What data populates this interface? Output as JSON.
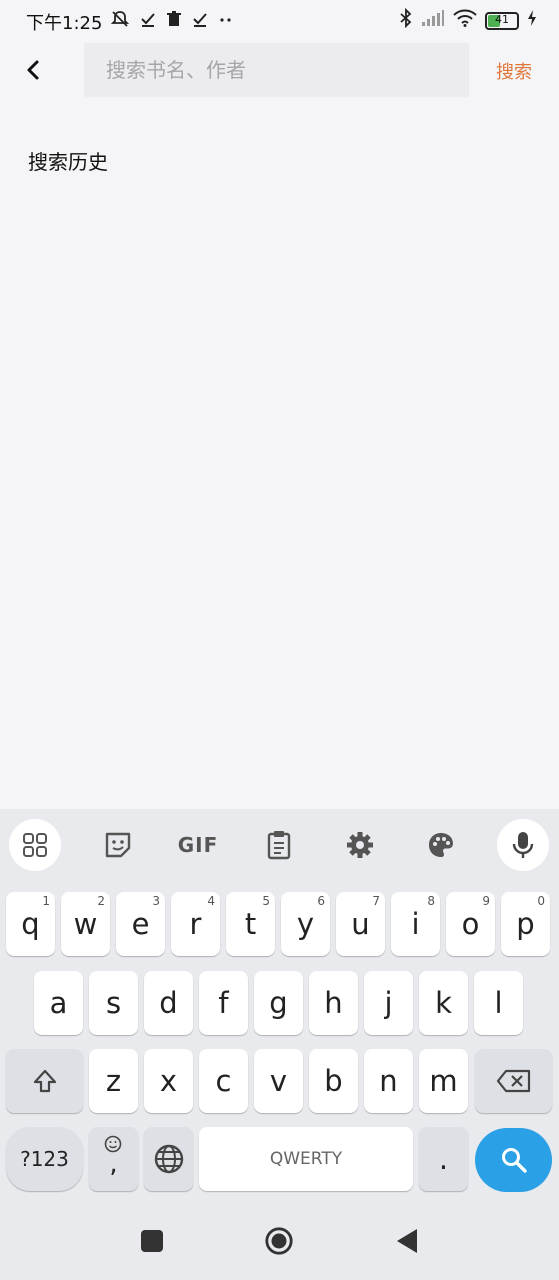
{
  "status_bar": {
    "time": "下午1:25",
    "battery_level": "41",
    "left_icons": [
      "bell-off-icon",
      "check-icon",
      "trash-icon",
      "check-icon",
      "more-dots-icon"
    ],
    "right_icons": [
      "bluetooth-icon",
      "signal-icon",
      "wifi-icon",
      "battery-icon",
      "charging-icon"
    ]
  },
  "header": {
    "search_placeholder": "搜索书名、作者",
    "search_value": "",
    "search_button_label": "搜索"
  },
  "history": {
    "title": "搜索历史",
    "items": []
  },
  "keyboard": {
    "toolbar": [
      "apps-icon",
      "sticker-icon",
      "GIF",
      "clipboard-icon",
      "settings-icon",
      "palette-icon",
      "mic-icon"
    ],
    "gif_label": "GIF",
    "row1": [
      {
        "key": "q",
        "hint": "1"
      },
      {
        "key": "w",
        "hint": "2"
      },
      {
        "key": "e",
        "hint": "3"
      },
      {
        "key": "r",
        "hint": "4"
      },
      {
        "key": "t",
        "hint": "5"
      },
      {
        "key": "y",
        "hint": "6"
      },
      {
        "key": "u",
        "hint": "7"
      },
      {
        "key": "i",
        "hint": "8"
      },
      {
        "key": "o",
        "hint": "9"
      },
      {
        "key": "p",
        "hint": "0"
      }
    ],
    "row2": [
      "a",
      "s",
      "d",
      "f",
      "g",
      "h",
      "j",
      "k",
      "l"
    ],
    "row3": [
      "z",
      "x",
      "c",
      "v",
      "b",
      "n",
      "m"
    ],
    "symbols_label": "?123",
    "comma_label": ",",
    "space_label": "QWERTY",
    "period_label": ".",
    "accent_color": "#2aa1e6"
  },
  "colors": {
    "background": "#f5f5f7",
    "search_action": "#e0763a"
  }
}
